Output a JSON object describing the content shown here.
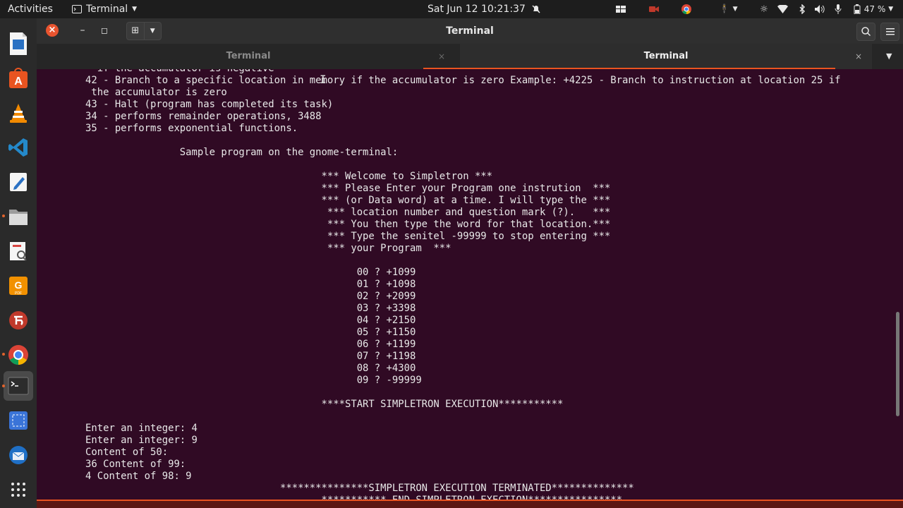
{
  "topbar": {
    "activities": "Activities",
    "app_name": "Terminal",
    "clock": "Sat Jun 12  10:21:37",
    "battery": "47 %",
    "tray_icons": [
      "windows-icon",
      "screen-record-icon",
      "chrome-icon",
      "accessibility-icon",
      "brightness-icon",
      "wifi-icon",
      "bluetooth-icon",
      "volume-icon",
      "microphone-icon",
      "battery-icon"
    ]
  },
  "dock": {
    "items": [
      "libreoffice-writer",
      "ubuntu-software",
      "vlc",
      "vscode",
      "text-editor",
      "files",
      "document-viewer",
      "pdf-tool",
      "app-red",
      "chrome",
      "terminal",
      "screenshot-tool",
      "thunderbird"
    ]
  },
  "window": {
    "title": "Terminal",
    "close_glyph": "×",
    "min_glyph": "–",
    "max_glyph": "◻"
  },
  "tabs": [
    {
      "label": "Terminal",
      "active": false
    },
    {
      "label": "Terminal",
      "active": true
    }
  ],
  "terminal": {
    "background": "#300a24",
    "lines": [
      "  if the accumulator is negative",
      "42 - Branch to a specific location in memory if the accumulator is zero Example: +4225 - Branch to instruction at location 25 if",
      " the accumulator is zero",
      "43 - Halt (program has completed its task)",
      "34 - performs remainder operations, 3488",
      "35 - performs exponential functions.",
      "",
      "                Sample program on the gnome-terminal:",
      "",
      "                                        *** Welcome to Simpletron ***",
      "                                        *** Please Enter your Program one instrution  ***",
      "                                        *** (or Data word) at a time. I will type the ***",
      "                                         *** location number and question mark (?).   ***",
      "                                         *** You then type the word for that location.***",
      "                                         *** Type the senitel -99999 to stop entering ***",
      "                                         *** your Program  ***",
      "",
      "                                              00 ? +1099",
      "                                              01 ? +1098",
      "                                              02 ? +2099",
      "                                              03 ? +3398",
      "                                              04 ? +2150",
      "                                              05 ? +1150",
      "                                              06 ? +1199",
      "                                              07 ? +1198",
      "                                              08 ? +4300",
      "                                              09 ? -99999",
      "",
      "                                        ****START SIMPLETRON EXECUTION***********",
      "",
      "Enter an integer: 4",
      "Enter an integer: 9",
      "Content of 50:",
      "36 Content of 99:",
      "4 Content of 98: 9",
      "                                 ***************SIMPLETRON EXECUTION TERMINATED**************",
      "                                        *********** END SIMPLETRON EXECTION****************"
    ]
  }
}
